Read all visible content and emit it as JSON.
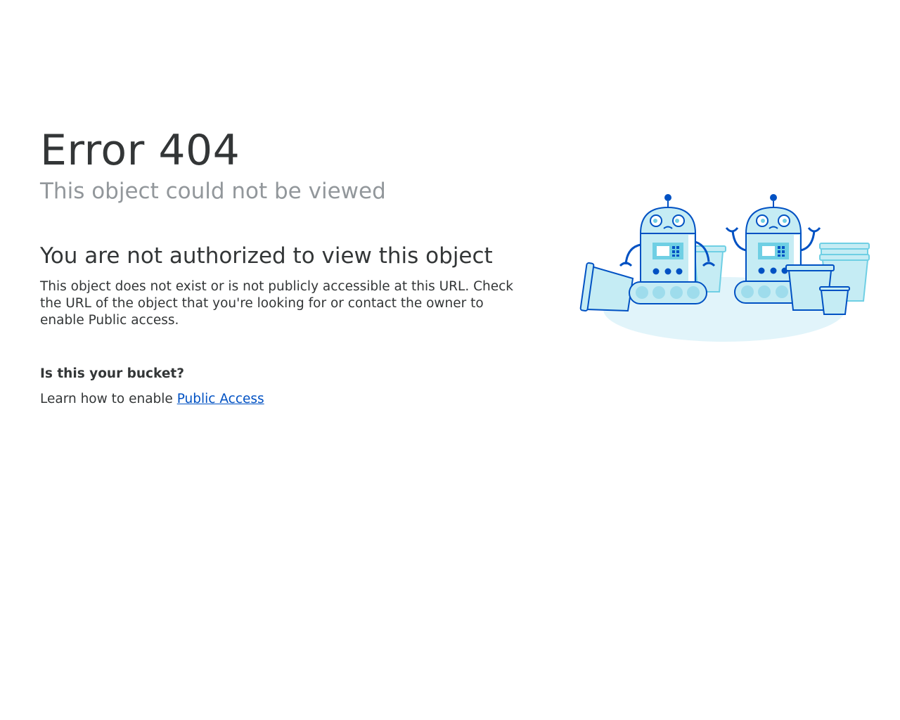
{
  "error": {
    "code_title": "Error 404",
    "subtitle": "This object could not be viewed"
  },
  "main": {
    "heading": "You are not authorized to view this object",
    "description": "This object does not exist or is not publicly accessible at this URL. Check the URL of the object that you're looking for or contact the owner to enable Public access."
  },
  "help": {
    "question": "Is this your bucket?",
    "prefix": "Learn how to enable ",
    "link_label": "Public Access"
  },
  "colors": {
    "link": "#0051c3",
    "title": "#333637",
    "subtitle": "#92979b",
    "illustration_blue": "#0051c3",
    "illustration_light": "#c5ecf4"
  },
  "illustration": {
    "icon": "robots-with-buckets-illustration"
  }
}
